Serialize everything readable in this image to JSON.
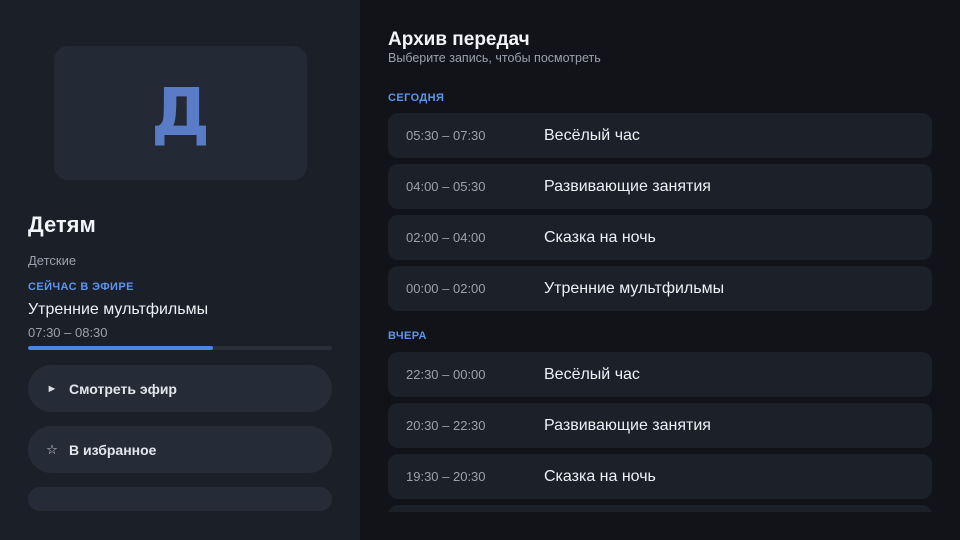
{
  "channel": {
    "logo_letter": "Д",
    "name": "Детям",
    "genre": "Детские",
    "now_label": "СЕЙЧАС В ЭФИРЕ",
    "now_title": "Утренние мультфильмы",
    "now_time": "07:30 – 08:30",
    "progress_fraction": 0.61
  },
  "buttons": {
    "watch_icon": "play-icon",
    "watch_glyph": "►",
    "watch_label": "Смотреть эфир",
    "fav_icon": "star-icon",
    "fav_glyph": "☆",
    "fav_label": "В избранное"
  },
  "archive": {
    "title": "Архив передач",
    "subtitle": "Выберите запись, чтобы посмотреть",
    "sections": [
      {
        "label": "СЕГОДНЯ",
        "items": [
          {
            "time": "05:30 – 07:30",
            "title": "Весёлый час"
          },
          {
            "time": "04:00 – 05:30",
            "title": "Развивающие занятия"
          },
          {
            "time": "02:00 – 04:00",
            "title": "Сказка на ночь"
          },
          {
            "time": "00:00 – 02:00",
            "title": "Утренние мультфильмы"
          }
        ]
      },
      {
        "label": "ВЧЕРА",
        "items": [
          {
            "time": "22:30 – 00:00",
            "title": "Весёлый час"
          },
          {
            "time": "20:30 – 22:30",
            "title": "Развивающие занятия"
          },
          {
            "time": "19:30 – 20:30",
            "title": "Сказка на ночь"
          },
          {
            "time": "",
            "title": ""
          }
        ]
      }
    ]
  },
  "colors": {
    "accent": "#4a86e3",
    "label_blue": "#5b95ef",
    "panel": "#1b1f27",
    "background": "#111318"
  }
}
